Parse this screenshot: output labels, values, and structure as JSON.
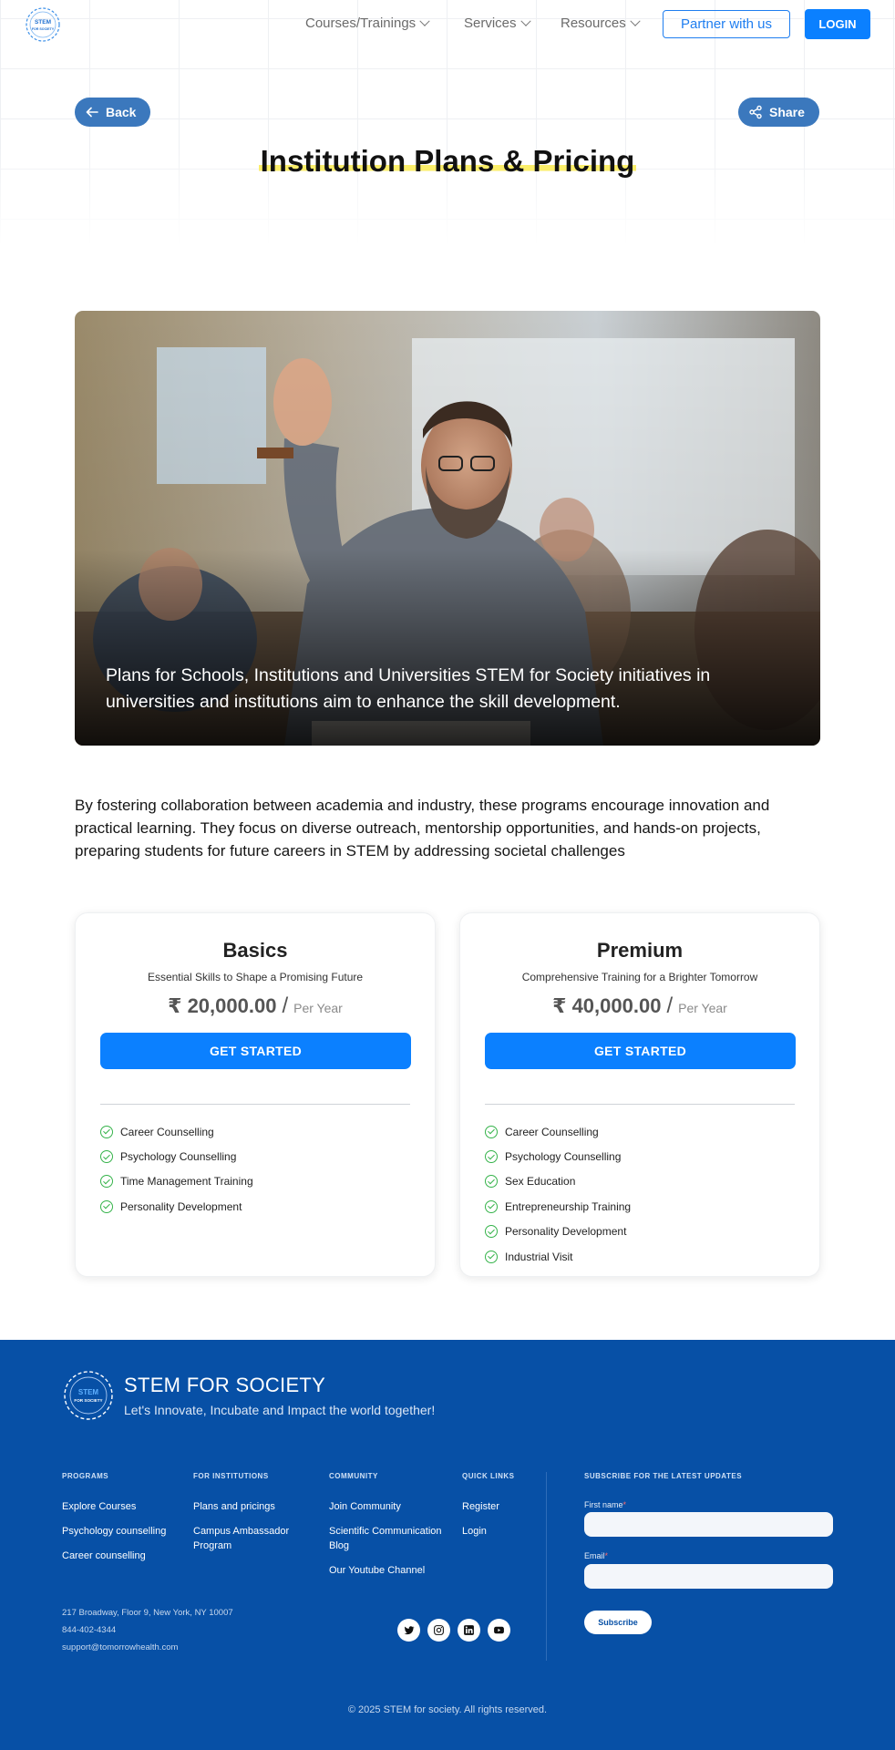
{
  "nav": {
    "logo_text_top": "STEM",
    "logo_text_bottom": "FOR SOCIETY",
    "items": [
      {
        "label": "Courses/Trainings"
      },
      {
        "label": "Services"
      },
      {
        "label": "Resources"
      }
    ],
    "partner_label": "Partner with us",
    "login_label": "LOGIN"
  },
  "hero": {
    "back_label": "Back",
    "share_label": "Share",
    "title": "Institution Plans & Pricing"
  },
  "banner": {
    "caption": "Plans for Schools, Institutions and Universities STEM for Society initiatives in universities and institutions aim to enhance the skill development."
  },
  "intro": "By fostering collaboration between academia and industry, these programs encourage innovation and practical learning. They focus on diverse outreach, mentorship opportunities, and hands-on projects, preparing students for future careers in STEM by addressing societal challenges",
  "plans": [
    {
      "name": "Basics",
      "subtitle": "Essential Skills to Shape a Promising Future",
      "price": "₹ 20,000.00",
      "slash": "/",
      "period": "Per Year",
      "cta": "GET STARTED",
      "features": [
        "Career Counselling",
        "Psychology Counselling",
        "Time Management Training",
        "Personality Development"
      ]
    },
    {
      "name": "Premium",
      "subtitle": "Comprehensive Training for a Brighter Tomorrow",
      "price": "₹ 40,000.00",
      "slash": "/",
      "period": "Per Year",
      "cta": "GET STARTED",
      "features": [
        "Career Counselling",
        "Psychology Counselling",
        "Sex Education",
        "Entrepreneurship Training",
        "Personality Development",
        "Industrial Visit"
      ]
    }
  ],
  "footer": {
    "brand": "STEM FOR SOCIETY",
    "tagline": "Let's Innovate, Incubate and Impact the world together!",
    "columns": [
      {
        "heading": "PROGRAMS",
        "links": [
          "Explore Courses",
          "Psychology counselling",
          "Career counselling"
        ]
      },
      {
        "heading": "FOR INSTITUTIONS",
        "links": [
          "Plans and pricings",
          "Campus Ambassador Program"
        ]
      },
      {
        "heading": "COMMUNITY",
        "links": [
          "Join Community",
          "Scientific Communication Blog",
          "Our Youtube Channel"
        ]
      },
      {
        "heading": "QUICK LINKS",
        "links": [
          "Register",
          "Login"
        ]
      }
    ],
    "subscribe": {
      "heading": "SUBSCRIBE FOR THE LATEST UPDATES",
      "first_name_label": "First name",
      "email_label": "Email",
      "required_mark": "*",
      "button": "Subscribe"
    },
    "address": "217 Broadway, Floor 9, New York, NY 10007",
    "phone": "844-402-4344",
    "email": "support@tomorrowhealth.com",
    "social": [
      "twitter-icon",
      "instagram-icon",
      "linkedin-icon",
      "youtube-icon"
    ],
    "copyright": "© 2025 STEM for society. All rights reserved."
  },
  "colors": {
    "primary": "#0b80ff",
    "pill": "#3b78bd",
    "footer_bg": "#0750a6",
    "highlight": "#fbee6a",
    "check": "#35b34a"
  }
}
